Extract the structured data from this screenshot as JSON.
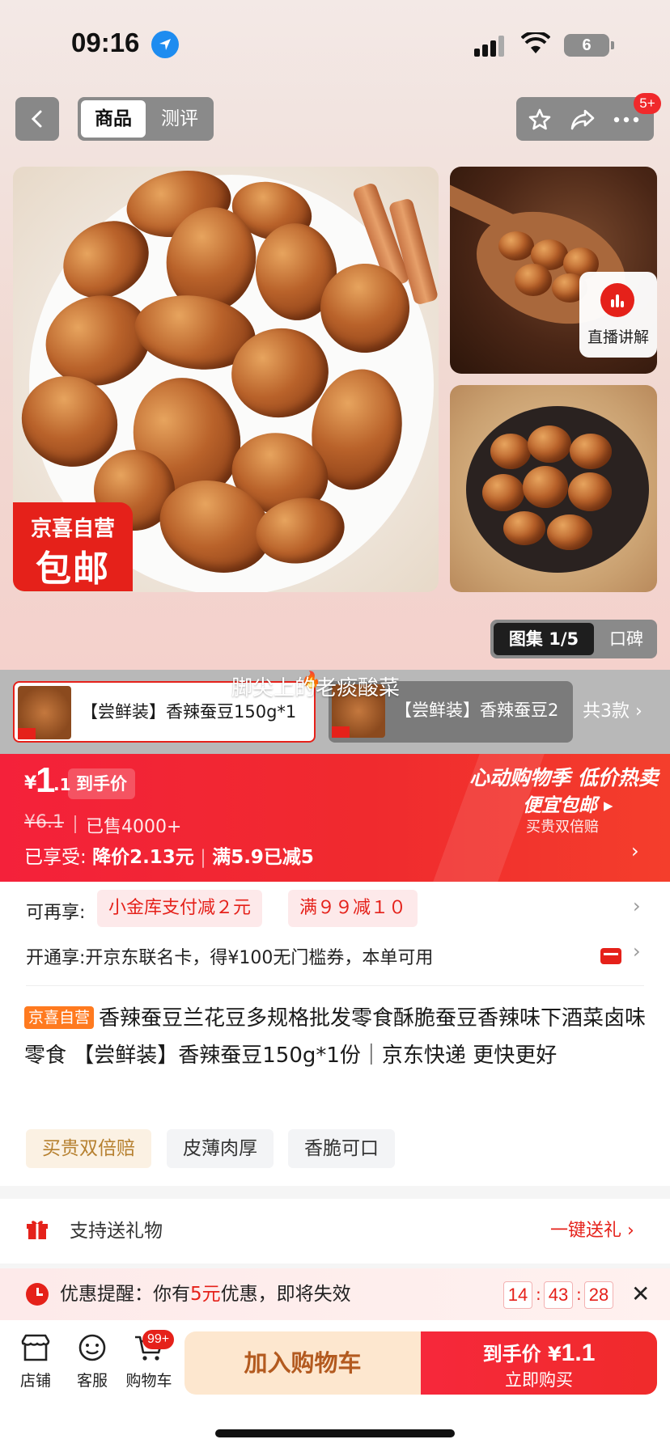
{
  "status_bar": {
    "time": "09:16",
    "battery": "6"
  },
  "nav": {
    "tab_active": "商品",
    "tab_inactive": "测评",
    "badge": "5+"
  },
  "gallery": {
    "promo_tag_line1": "京喜自营",
    "promo_tag_line2": "包邮",
    "live_label": "直播讲解",
    "pill_active": "图集 1/5",
    "pill_inactive": "口碑"
  },
  "sku": {
    "items": [
      {
        "label": "【尝鲜装】香辣蚕豆150g*1"
      },
      {
        "label": "【尝鲜装】香辣蚕豆2"
      }
    ],
    "more": "共3款",
    "live_comment": "脚尖上的老痰酸菜"
  },
  "price": {
    "currency": "¥",
    "integer": "1",
    "decimal": ".1",
    "tag": "到手价",
    "original": "¥6.1",
    "sold": "已售4000+",
    "enjoy_prefix": "已享受:",
    "enjoy_discount": "降价2.13元",
    "enjoy_threshold": "满5.9已减5",
    "promo_line1": "心动购物季 低价热卖",
    "promo_line2": "便宜包邮 ▸",
    "promo_line3": "买贵双倍赔"
  },
  "info": {
    "more_label": "可再享:",
    "coupons": [
      "小金库支付减２元",
      "满９９减１０"
    ],
    "open_label": "开通享:开京东联名卡，得¥100无门槛券，本单可用",
    "title_tag": "京喜自营",
    "title": "香辣蚕豆兰花豆多规格批发零食酥脆蚕豆香辣味下酒菜卤味零食 【尝鲜装】香辣蚕豆150g*1份｜京东快递 更快更好",
    "chips": [
      "买贵双倍赔",
      "皮薄肉厚",
      "香脆可口"
    ]
  },
  "gift": {
    "label": "支持送礼物",
    "link": "一键送礼 ›"
  },
  "reminder": {
    "prefix": "优惠提醒：你有",
    "amount": "5元",
    "suffix": "优惠，即将失效",
    "hours": "14",
    "minutes": "43",
    "seconds": "28"
  },
  "bottom": {
    "store": "店铺",
    "service": "客服",
    "cart": "购物车",
    "cart_badge": "99+",
    "add_cart": "加入购物车",
    "buy_prefix": "到手价 ¥",
    "buy_price": "1.1",
    "buy_action": "立即购买"
  },
  "colors": {
    "accent": "#e5211a",
    "cart_button": "#fde7cf",
    "gold": "#b6802f"
  }
}
